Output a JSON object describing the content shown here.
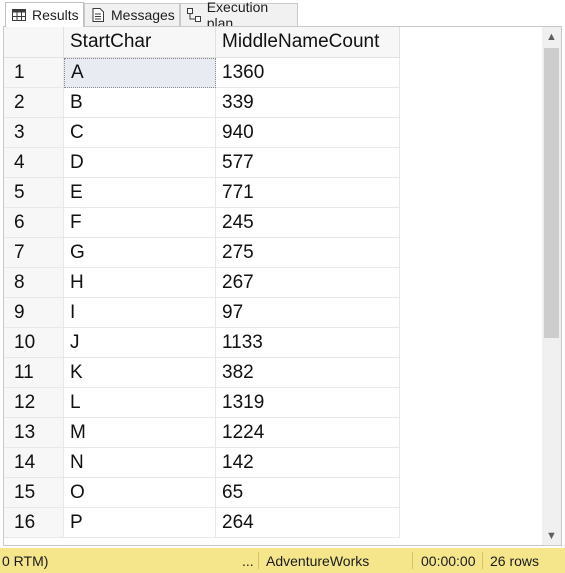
{
  "tabs": [
    {
      "label": "Results",
      "icon": "grid-icon",
      "active": true
    },
    {
      "label": "Messages",
      "icon": "messages-icon",
      "active": false
    },
    {
      "label": "Execution plan",
      "icon": "execution-plan-icon",
      "active": false
    }
  ],
  "grid": {
    "columns": [
      "StartChar",
      "MiddleNameCount"
    ],
    "rows": [
      {
        "num": "1",
        "StartChar": "A",
        "MiddleNameCount": "1360"
      },
      {
        "num": "2",
        "StartChar": "B",
        "MiddleNameCount": "339"
      },
      {
        "num": "3",
        "StartChar": "C",
        "MiddleNameCount": "940"
      },
      {
        "num": "4",
        "StartChar": "D",
        "MiddleNameCount": "577"
      },
      {
        "num": "5",
        "StartChar": "E",
        "MiddleNameCount": "771"
      },
      {
        "num": "6",
        "StartChar": "F",
        "MiddleNameCount": "245"
      },
      {
        "num": "7",
        "StartChar": "G",
        "MiddleNameCount": "275"
      },
      {
        "num": "8",
        "StartChar": "H",
        "MiddleNameCount": "267"
      },
      {
        "num": "9",
        "StartChar": "I",
        "MiddleNameCount": "97"
      },
      {
        "num": "10",
        "StartChar": "J",
        "MiddleNameCount": "1133"
      },
      {
        "num": "11",
        "StartChar": "K",
        "MiddleNameCount": "382"
      },
      {
        "num": "12",
        "StartChar": "L",
        "MiddleNameCount": "1319"
      },
      {
        "num": "13",
        "StartChar": "M",
        "MiddleNameCount": "1224"
      },
      {
        "num": "14",
        "StartChar": "N",
        "MiddleNameCount": "142"
      },
      {
        "num": "15",
        "StartChar": "O",
        "MiddleNameCount": "65"
      },
      {
        "num": "16",
        "StartChar": "P",
        "MiddleNameCount": "264"
      }
    ],
    "selected_cell": {
      "row": 0,
      "column": "StartChar"
    }
  },
  "status": {
    "server_fragment": "0 RTM)",
    "ellipsis": "...",
    "database": "AdventureWorks",
    "elapsed": "00:00:00",
    "row_count": "26 rows"
  },
  "colors": {
    "status_bar": "#f5e68c",
    "selected_cell": "#e8ecf2"
  }
}
